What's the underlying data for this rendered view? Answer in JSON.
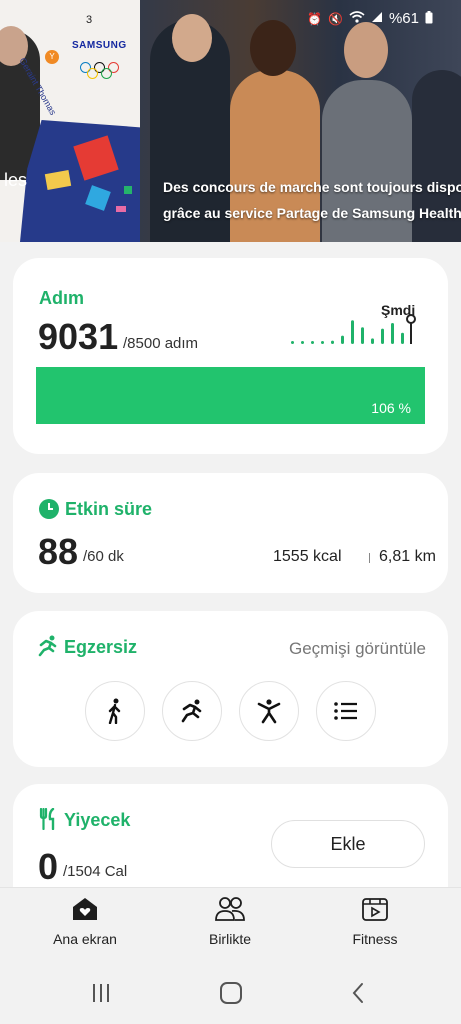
{
  "banner": {
    "counter": "3",
    "brand": "SAMSUNG",
    "side_text": "les",
    "badge": "Y",
    "signature": "Geraint Thomas",
    "caption_line1": "Des concours de marche sont toujours disponib",
    "caption_line2": "grâce au service Partage de Samsung Health"
  },
  "status_bar": {
    "battery": "%61",
    "icons": [
      "alarm-icon",
      "mute-icon",
      "wifi-icon",
      "signal-icon",
      "battery-icon"
    ]
  },
  "steps": {
    "title": "Adım",
    "count": "9031",
    "goal": "/8500 adım",
    "now_label": "Şmdi",
    "percent_label": "106 %",
    "progress": 1.06,
    "hourly_bars": [
      0.08,
      0.08,
      0.08,
      0.1,
      0.12,
      0.3,
      0.85,
      0.6,
      0.2,
      0.55,
      0.75,
      0.4
    ]
  },
  "active_time": {
    "title": "Etkin süre",
    "minutes": "88",
    "goal": "/60 dk",
    "calories": "1555 kcal",
    "distance": "6,81 km"
  },
  "exercise": {
    "title": "Egzersiz",
    "history_link": "Geçmişi görüntüle",
    "buttons": [
      "walking-icon",
      "running-icon",
      "workout-icon",
      "list-icon"
    ]
  },
  "food": {
    "title": "Yiyecek",
    "amount": "0",
    "goal": "/1504 Cal",
    "add_label": "Ekle"
  },
  "bottom_nav": {
    "items": [
      {
        "label": "Ana ekran",
        "icon": "home-heart-icon"
      },
      {
        "label": "Birlikte",
        "icon": "people-icon"
      },
      {
        "label": "Fitness",
        "icon": "play-box-icon"
      }
    ]
  },
  "colors": {
    "accent_green": "#1fb26a",
    "bar_green": "#22c46e",
    "card_bg": "#ffffff",
    "page_bg": "#f2f2f2"
  }
}
